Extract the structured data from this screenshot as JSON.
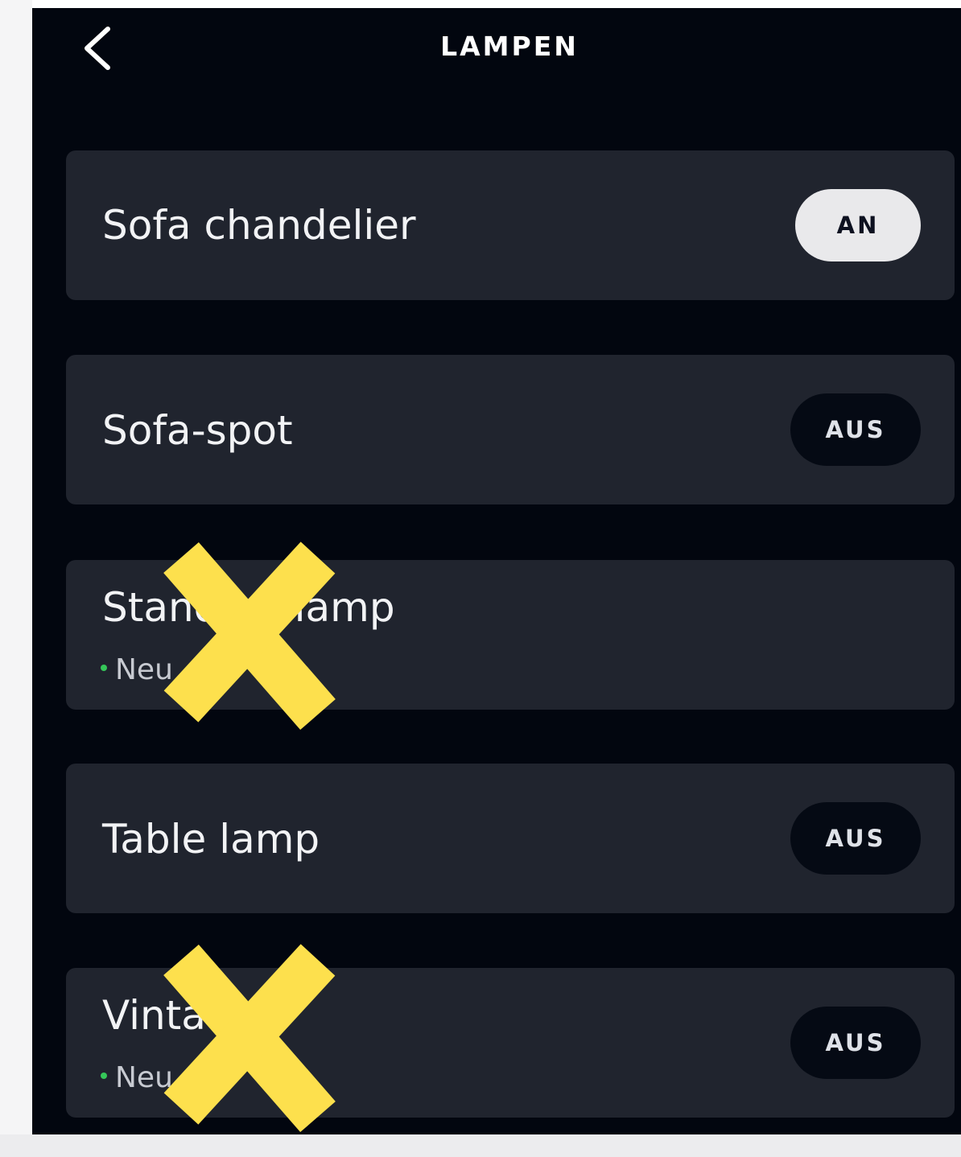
{
  "header": {
    "title": "LAMPEN",
    "back_icon": "chevron-left-icon"
  },
  "devices": [
    {
      "name": "Sofa chandelier",
      "subtitle": "",
      "toggle": "AN",
      "state": "on"
    },
    {
      "name": "Sofa-spot",
      "subtitle": "",
      "toggle": "AUS",
      "state": "off"
    },
    {
      "name": "Standing lamp",
      "subtitle": "Neu",
      "toggle": "",
      "state": ""
    },
    {
      "name": "Table lamp",
      "subtitle": "",
      "toggle": "AUS",
      "state": "off"
    },
    {
      "name": "Vinta",
      "subtitle": "Neu",
      "toggle": "AUS",
      "state": "off"
    }
  ],
  "overlay": {
    "mark_icon": "yellow-cross-icon",
    "mark_color": "#fde04d"
  },
  "colors": {
    "background": "#02060f",
    "card": "#20242e",
    "toggle_on": "#e9e9eb",
    "toggle_off": "#050a14",
    "new_dot": "#35c759"
  }
}
